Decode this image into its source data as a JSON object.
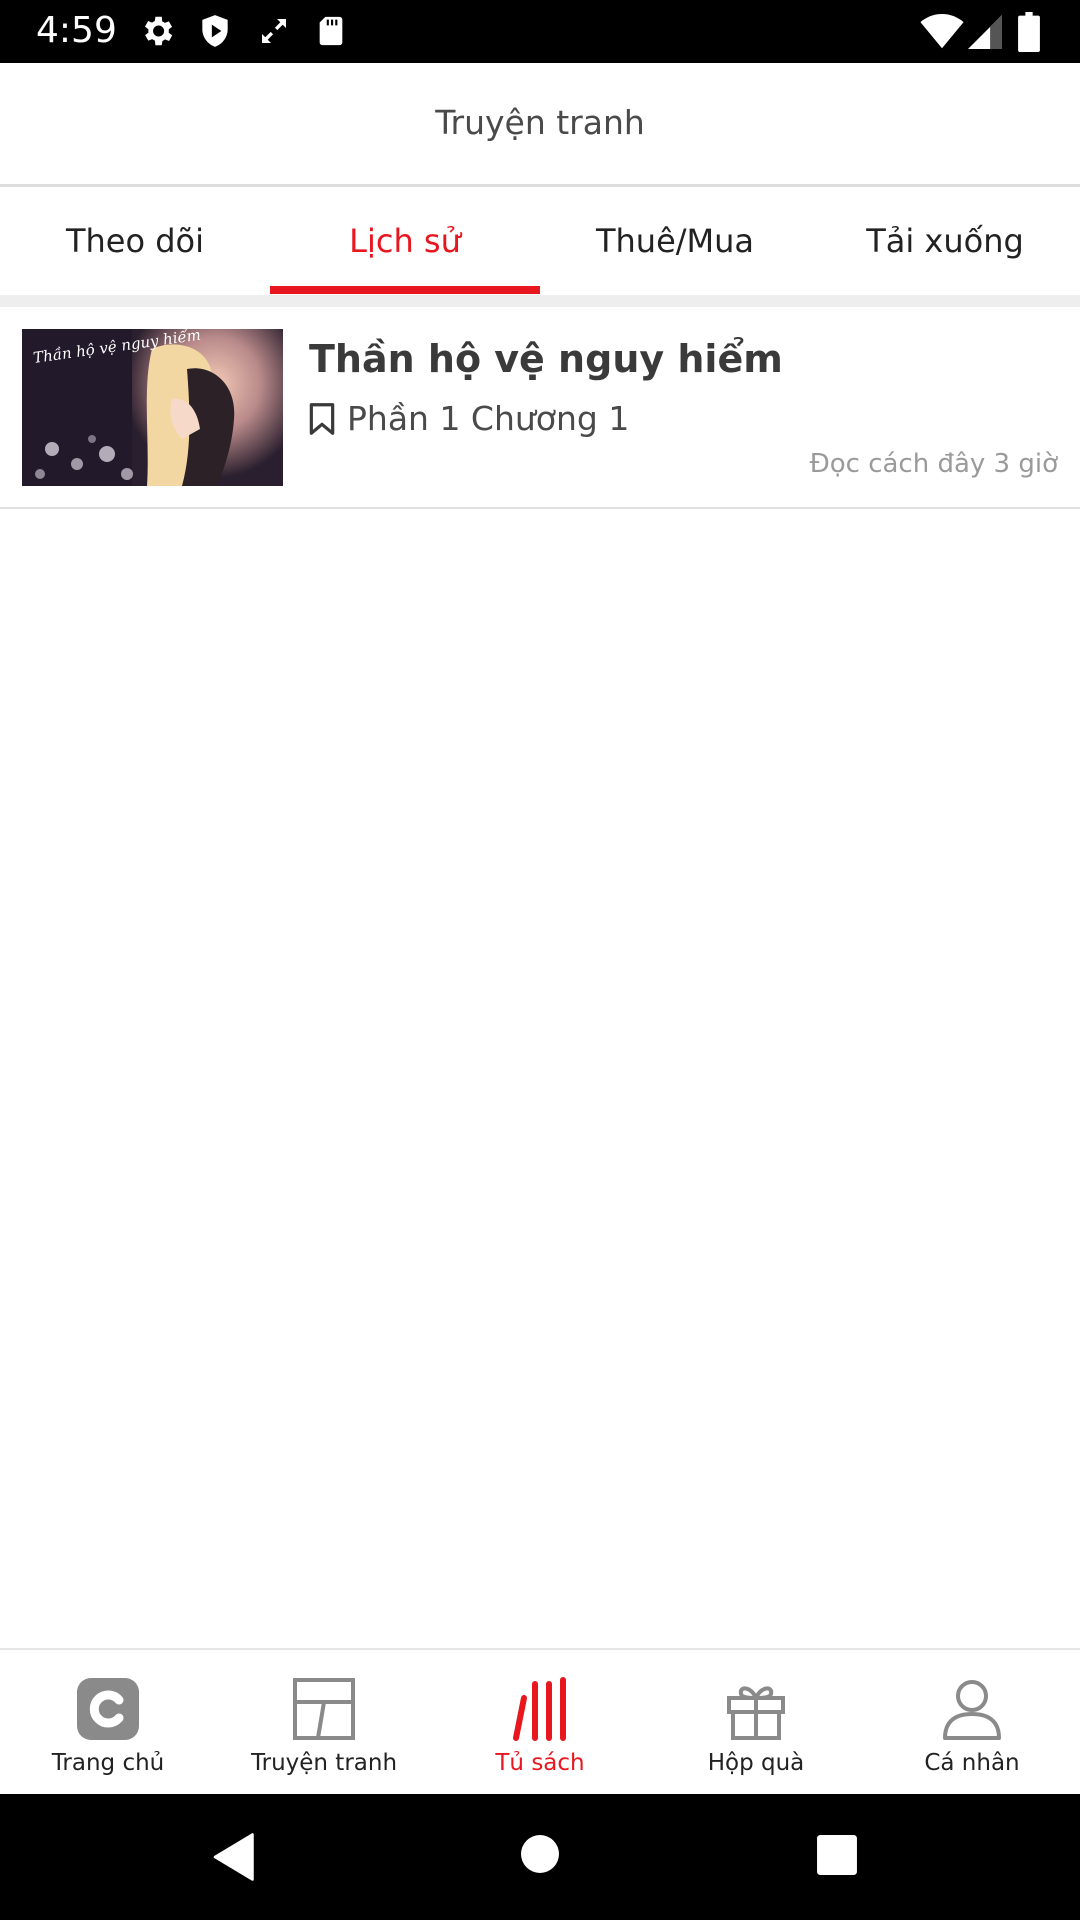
{
  "status_bar": {
    "time": "4:59"
  },
  "header": {
    "title": "Truyện tranh"
  },
  "tabs": [
    {
      "label": "Theo dõi"
    },
    {
      "label": "Lịch sử",
      "active": true
    },
    {
      "label": "Thuê/Mua"
    },
    {
      "label": "Tải xuống"
    }
  ],
  "history": [
    {
      "cover_text": "Thần hộ vệ nguy hiểm",
      "title": "Thần hộ vệ nguy hiểm",
      "chapter": "Phần 1 Chương 1",
      "read_time": "Đọc cách đây 3 giờ"
    }
  ],
  "bottom_nav": [
    {
      "label": "Trang chủ",
      "icon": "home-c-icon"
    },
    {
      "label": "Truyện tranh",
      "icon": "comic-panel-icon"
    },
    {
      "label": "Tủ sách",
      "icon": "bookshelf-icon",
      "active": true
    },
    {
      "label": "Hộp quà",
      "icon": "gift-icon"
    },
    {
      "label": "Cá nhân",
      "icon": "person-icon"
    }
  ],
  "colors": {
    "accent": "#e8161e",
    "text": "#222222",
    "muted": "#9a9a9a"
  }
}
